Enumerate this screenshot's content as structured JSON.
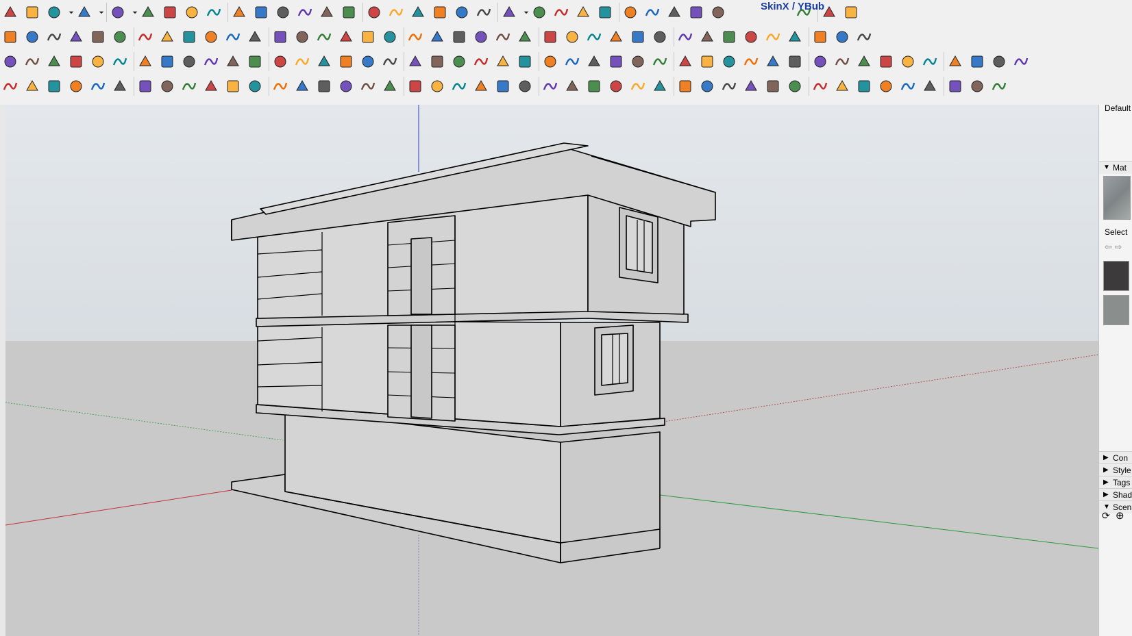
{
  "toolbar": {
    "skinx_label": "SkinX / YBub",
    "rows": [
      [
        "select-arrow",
        "eraser",
        "pencil",
        "dropdown",
        "freehand-arc",
        "dropdown",
        "rectangle-hatch",
        "dropdown",
        "push-pull",
        "follow-me",
        "move",
        "rotate",
        "scale",
        "tape-measure",
        "text",
        "paint-bucket",
        "orbit",
        "pan",
        "zoom",
        "zoom-extents",
        "section-plane",
        "layers-a",
        "layers-b",
        "layers-c",
        "user",
        "dropdown",
        "warehouse",
        "tag",
        "solid-a",
        "solid-b",
        "solid-c",
        "solid-d",
        "skinx-shoe-a",
        "skinx-shoe-b",
        "skinx-shoe-c",
        "play",
        "stop",
        "help"
      ],
      [
        "move-left",
        "polyline",
        "eraser-red",
        "scissors",
        "gear",
        "polygon-3d",
        "curve",
        "box",
        "globe",
        "spiral",
        "corner-a",
        "corner-b",
        "line-red",
        "curve-b",
        "face-a",
        "face-b",
        "bars-a",
        "bars-b",
        "hand",
        "ruler",
        "plane",
        "stairs",
        "slope",
        "arrows-a",
        "arrows-b",
        "arrows-c",
        "rock",
        "stripes-a",
        "stripes-b",
        "stairs-b",
        "grid-a",
        "grid-b",
        "grid-c",
        "stripes-c",
        "sphere-a",
        "sphere-b",
        "stripes-d",
        "stripes-e",
        "house-arrow"
      ],
      [
        "diamond-blue",
        "diamond-yellow",
        "diamond-green",
        "diamond-red",
        "box-outline",
        "orange-curve",
        "red-square",
        "grid-table",
        "flag",
        "brown-box",
        "chain",
        "corner-c",
        "dots-red",
        "cross-red",
        "cross-green",
        "cross-blue",
        "cone-green",
        "cone-cyan",
        "triangle-yellow",
        "arc-orange",
        "arc-red",
        "spiral-b",
        "arrow-move",
        "cube-brown",
        "undo-red",
        "green-flow",
        "rotate-cube",
        "red-cubes",
        "cubes-b",
        "red-box-b",
        "multi-cube",
        "cube-blue",
        "grid-orange",
        "grid-orange-b",
        "grid-orange-c",
        "x-red",
        "circle-dots",
        "grid-d",
        "pencil-line",
        "axis-cross",
        "arrow-scroll",
        "brush",
        "paint-drop",
        "pencil-blue",
        "hook",
        "scale-balance"
      ],
      [
        "hand-b",
        "person",
        "globe-green",
        "arc-a",
        "wave",
        "zigzag",
        "curve-c",
        "i-beam",
        "arc-green",
        "square",
        "spiral-c",
        "arc-b",
        "wave-b",
        "arc-c",
        "arc-d",
        "arc-red-b",
        "line-green",
        "circle",
        "wrench",
        "circle-red",
        "tag-red",
        "terrain",
        "house-green",
        "cursor",
        "scale-green",
        "scale-green-b",
        "lines-a",
        "lines-b",
        "lines-c",
        "dash-a",
        "dash-b",
        "dash-c",
        "frame-x",
        "frame-grid",
        "frame-x-red",
        "window-a",
        "window-b",
        "frame-c",
        "building-a",
        "brick",
        "dome",
        "chess",
        "copy-a",
        "copy-b",
        "stack"
      ]
    ]
  },
  "tray": {
    "default_label": "Default",
    "materials_label": "Mat",
    "select_label": "Select",
    "sections": [
      {
        "label": "Con",
        "expanded": false
      },
      {
        "label": "Style",
        "expanded": false
      },
      {
        "label": "Tags",
        "expanded": false
      },
      {
        "label": "Shad",
        "expanded": false
      },
      {
        "label": "Scen",
        "expanded": true
      }
    ]
  },
  "viewport": {
    "sky_color": "#dde3e8",
    "ground_color": "#c9c9c9",
    "model": "two-storey-house-on-plinth"
  }
}
